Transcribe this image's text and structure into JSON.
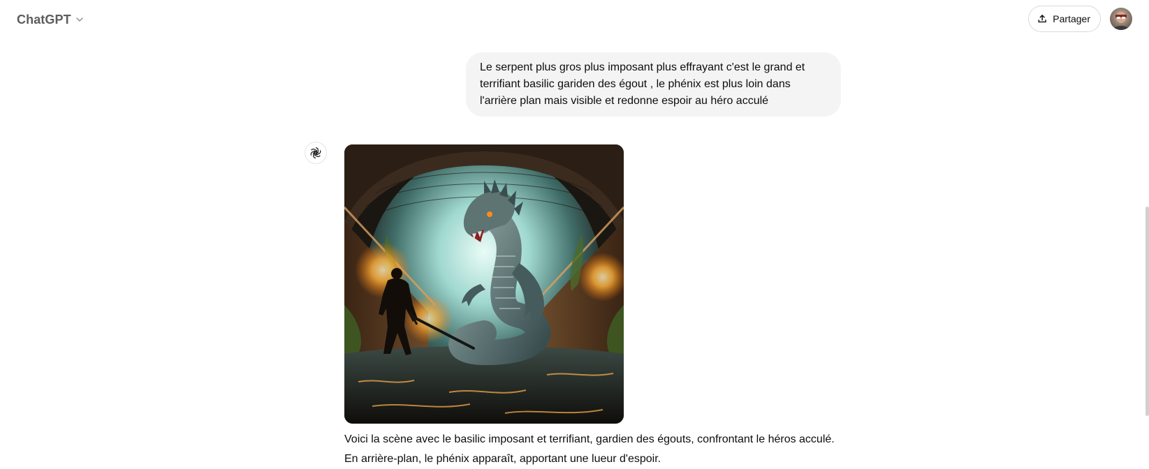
{
  "header": {
    "model_name": "ChatGPT",
    "share_label": "Partager"
  },
  "conversation": {
    "user_message": "Le serpent plus gros plus imposant plus effrayant c'est le grand et terrifiant basilic gariden des égout , le phénix est plus loin dans l'arrière plan mais visible et redonne espoir au héro acculé",
    "assistant_text": "Voici la scène avec le basilic imposant et terrifiant, gardien des égouts, confrontant le héros acculé. En arrière-plan, le phénix apparaît, apportant une lueur d'espoir."
  },
  "icons": {
    "model_dropdown": "chevron-down-icon",
    "share": "upload-share-icon",
    "assistant": "openai-logo-icon"
  },
  "colors": {
    "bubble_bg": "#f4f4f4",
    "text": "#0d0d0d",
    "muted": "#5d5d5d",
    "border": "#d9d9d9"
  }
}
